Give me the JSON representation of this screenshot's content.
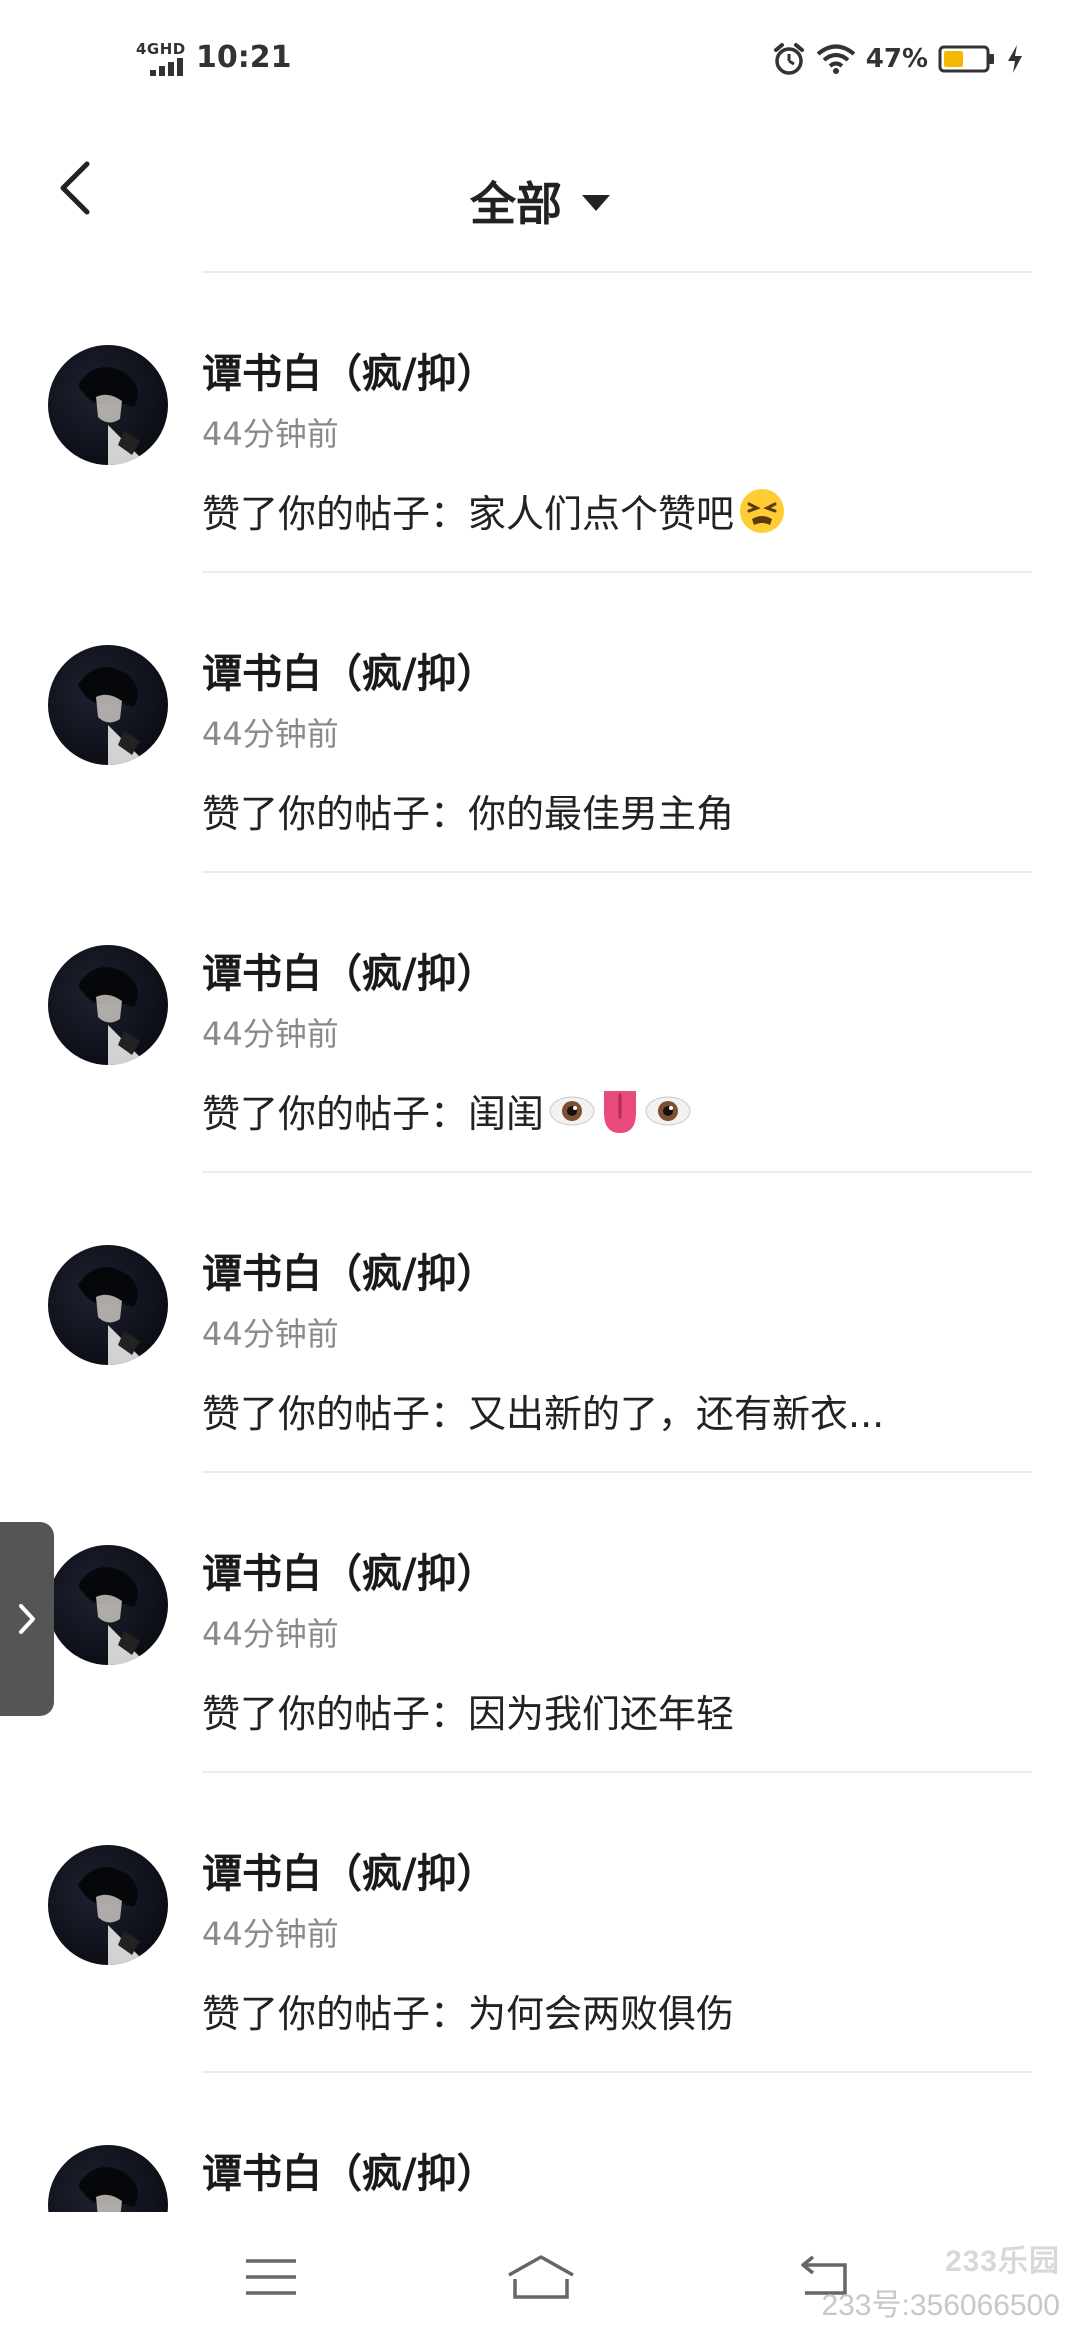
{
  "status_bar": {
    "network": "4GHD",
    "time": "10:21",
    "battery_percent": "47%",
    "battery_level": 0.47,
    "icons": [
      "alarm-icon",
      "wifi-icon",
      "battery-icon",
      "charging-icon"
    ]
  },
  "header": {
    "title": "全部",
    "back_icon": "chevron-left-icon",
    "dropdown_icon": "caret-down-icon"
  },
  "notifications": [
    {
      "name": "谭书白（疯/抑）",
      "time": "44分钟前",
      "message": "赞了你的帖子：家人们点个赞吧",
      "emoji": [
        "tired-face-emoji"
      ]
    },
    {
      "name": "谭书白（疯/抑）",
      "time": "44分钟前",
      "message": "赞了你的帖子：你的最佳男主角",
      "emoji": []
    },
    {
      "name": "谭书白（疯/抑）",
      "time": "44分钟前",
      "message": "赞了你的帖子：闺闺",
      "emoji": [
        "eye-emoji",
        "tongue-emoji",
        "eye-emoji"
      ]
    },
    {
      "name": "谭书白（疯/抑）",
      "time": "44分钟前",
      "message": "赞了你的帖子：又出新的了，还有新衣...",
      "emoji": []
    },
    {
      "name": "谭书白（疯/抑）",
      "time": "44分钟前",
      "message": "赞了你的帖子：因为我们还年轻",
      "emoji": []
    },
    {
      "name": "谭书白（疯/抑）",
      "time": "44分钟前",
      "message": "赞了你的帖子：为何会两败俱伤",
      "emoji": []
    },
    {
      "name": "谭书白（疯/抑）",
      "time": "",
      "message": "",
      "emoji": []
    }
  ],
  "side_tab": {
    "icon": "chevron-right-icon"
  },
  "bottom_nav": {
    "items": [
      "menu-icon",
      "home-icon",
      "back-icon"
    ]
  },
  "watermark": {
    "logo": "233乐园",
    "id": "233号:356066500"
  },
  "colors": {
    "text_primary": "#1a1a1a",
    "text_secondary": "#8a8a8a",
    "divider": "#ececec",
    "battery_fill": "#f5b800"
  }
}
